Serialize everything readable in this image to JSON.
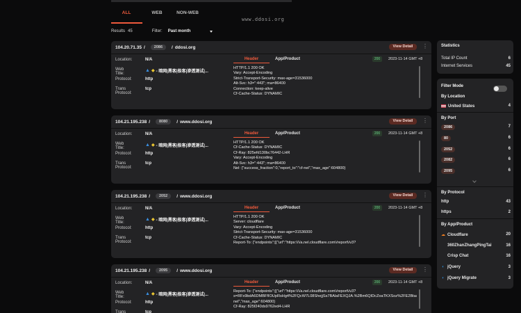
{
  "watermark": "www.ddosi.org",
  "tabs": [
    {
      "label": "ALL",
      "active": true
    },
    {
      "label": "WEB",
      "active": false
    },
    {
      "label": "NON-WEB",
      "active": false
    }
  ],
  "results": {
    "label": "Results",
    "count": "45"
  },
  "filter": {
    "label": "Filter:",
    "value": "Past month"
  },
  "detail_label": "View Detail",
  "field_labels": {
    "location": "Location:",
    "web_title": "Web Title:",
    "protocol": "Protocol:",
    "trans_protocol": "Trans Protocol:"
  },
  "detail_tabs": {
    "header": "Header",
    "app": "App/Product"
  },
  "cards": [
    {
      "ip": "104.20.71.35",
      "port": "2086",
      "domain": "ddosi.org",
      "location": "N/A",
      "web_title": "- 暗网|黑客|极客|渗透测试|...",
      "protocol": "http",
      "trans_protocol": "tcp",
      "status": "200",
      "timestamp": "2023-11-14 GMT +8",
      "header_lines": [
        "HTTP/1.1 200 OK",
        "Vary: Accept-Encoding",
        "Strict-Transport-Security: max-age=31536000",
        "Alt-Svc: h3=\":443\"; ma=86400",
        "Connection: keep-alive",
        "Cf-Cache-Status: DYNAMIC"
      ]
    },
    {
      "ip": "104.21.195.238",
      "port": "8080",
      "domain": "www.ddosi.org",
      "location": "N/A",
      "web_title": "- 暗网|黑客|极客|渗透测试|...",
      "protocol": "http",
      "trans_protocol": "tcp",
      "status": "200",
      "timestamp": "2023-11-14 GMT +8",
      "header_lines": [
        "HTTP/1.1 200 OK",
        "Cf-Cache-Status: DYNAMIC",
        "Cf-Ray: 825efd130bc76442-LHR",
        "Vary: Accept-Encoding",
        "Alt-Svc: h3=\":443\"; ma=86400",
        "Nel: {\"success_fraction\":0,\"report_to\":\"cf-nel\",\"max_age\":604800}"
      ]
    },
    {
      "ip": "104.21.195.238",
      "port": "2052",
      "domain": "www.ddosi.org",
      "location": "N/A",
      "web_title": "- 暗网|黑客|极客|渗透测试|...",
      "protocol": "http",
      "trans_protocol": "tcp",
      "status": "200",
      "timestamp": "2023-11-14 GMT +8",
      "header_lines": [
        "HTTP/1.1 200 OK",
        "Server: cloudflare",
        "Vary: Accept-Encoding",
        "Strict-Transport-Security: max-age=31536000",
        "Cf-Cache-Status: DYNAMIC",
        "Report-To: {\"endpoints\":[{\"url\":\"https:\\/\\/a.nel.cloudflare.com\\/report\\/v3?"
      ]
    },
    {
      "ip": "104.21.195.238",
      "port": "2095",
      "domain": "www.ddosi.org",
      "location": "N/A",
      "web_title": "- 暗网|黑客|极客|渗透测试|...",
      "protocol": "http",
      "trans_protocol": "tcp",
      "status": "200",
      "timestamp": "2023-11-14 GMT +8",
      "header_lines": [
        "Report-To: {\"endpoints\":[{\"url\":\"https:\\/\\/a.nel.cloudflare.com\\/report\\/v3?",
        "s=RFx9bdA6DMBFfIOUpRsHg4%2FQcW7L08ShejjSs7BAlaFEXQJA.%2Bm6QIDcZoaTKXSoz%2FE2Btas2",
        "nel\",\"max_age\":604800}",
        "Cf-Ray: 825f240ds9762ed4-LHR"
      ]
    }
  ],
  "sidebar": {
    "statistics": {
      "title": "Statistics",
      "rows": [
        {
          "label": "Total IP Count",
          "value": "6"
        },
        {
          "label": "Internet Services",
          "value": "45"
        }
      ]
    },
    "filter_mode": "Filter Mode",
    "by_location": {
      "title": "By Location",
      "items": [
        {
          "label": "United States",
          "count": "4"
        }
      ]
    },
    "by_port": {
      "title": "By Port",
      "items": [
        {
          "label": "2086",
          "count": "7"
        },
        {
          "label": "80",
          "count": "6"
        },
        {
          "label": "2052",
          "count": "6"
        },
        {
          "label": "2082",
          "count": "6"
        },
        {
          "label": "2095",
          "count": "6"
        }
      ]
    },
    "by_protocol": {
      "title": "By Protocol",
      "items": [
        {
          "label": "http",
          "count": "43"
        },
        {
          "label": "https",
          "count": "2"
        }
      ]
    },
    "by_app": {
      "title": "By App/Product",
      "items": [
        {
          "label": "Cloudflare",
          "count": "20"
        },
        {
          "label": "360ZhanZhangPingTai",
          "count": "16"
        },
        {
          "label": "Crisp Chat",
          "count": "16"
        },
        {
          "label": "jQuery",
          "count": "3"
        },
        {
          "label": "jQuery Migrate",
          "count": "3"
        }
      ]
    }
  }
}
